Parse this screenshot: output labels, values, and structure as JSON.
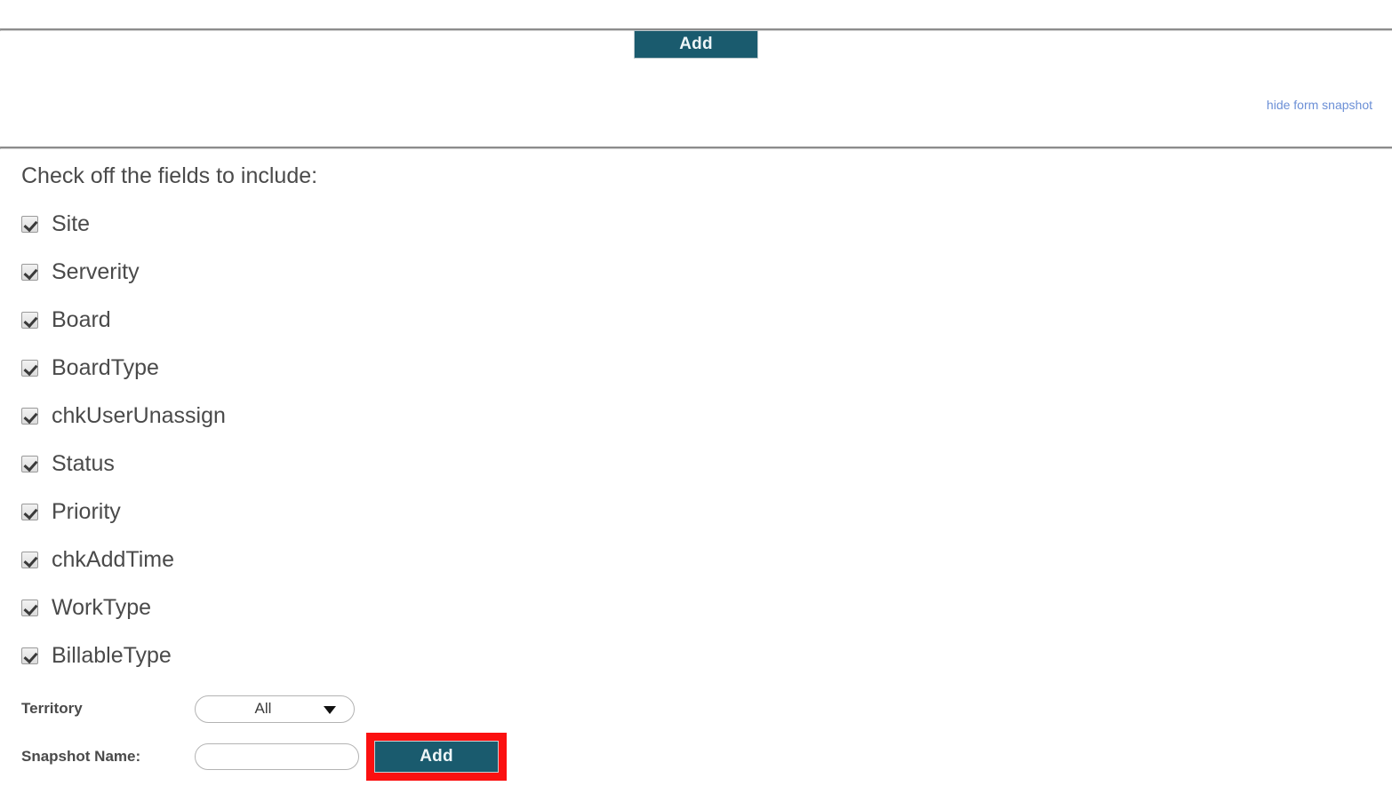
{
  "toolbar": {
    "add_label": "Add"
  },
  "links": {
    "hide_form_snapshot": "hide form snapshot"
  },
  "form": {
    "instruction": "Check off the fields to include:",
    "fields": [
      {
        "label": "Site",
        "checked": true
      },
      {
        "label": "Serverity",
        "checked": true
      },
      {
        "label": "Board",
        "checked": true
      },
      {
        "label": "BoardType",
        "checked": true
      },
      {
        "label": "chkUserUnassign",
        "checked": true
      },
      {
        "label": "Status",
        "checked": true
      },
      {
        "label": "Priority",
        "checked": true
      },
      {
        "label": "chkAddTime",
        "checked": true
      },
      {
        "label": "WorkType",
        "checked": true
      },
      {
        "label": "BillableType",
        "checked": true
      }
    ],
    "territory": {
      "label": "Territory",
      "selected": "All"
    },
    "snapshot_name": {
      "label": "Snapshot Name:",
      "value": "",
      "placeholder": ""
    },
    "submit_label": "Add"
  },
  "colors": {
    "button_bg": "#1a5b6e",
    "button_text": "#eef6f8",
    "link": "#6b8fd6",
    "highlight_box": "#fb1010",
    "text": "#4a4a4a",
    "rule": "#8c8c8c"
  }
}
